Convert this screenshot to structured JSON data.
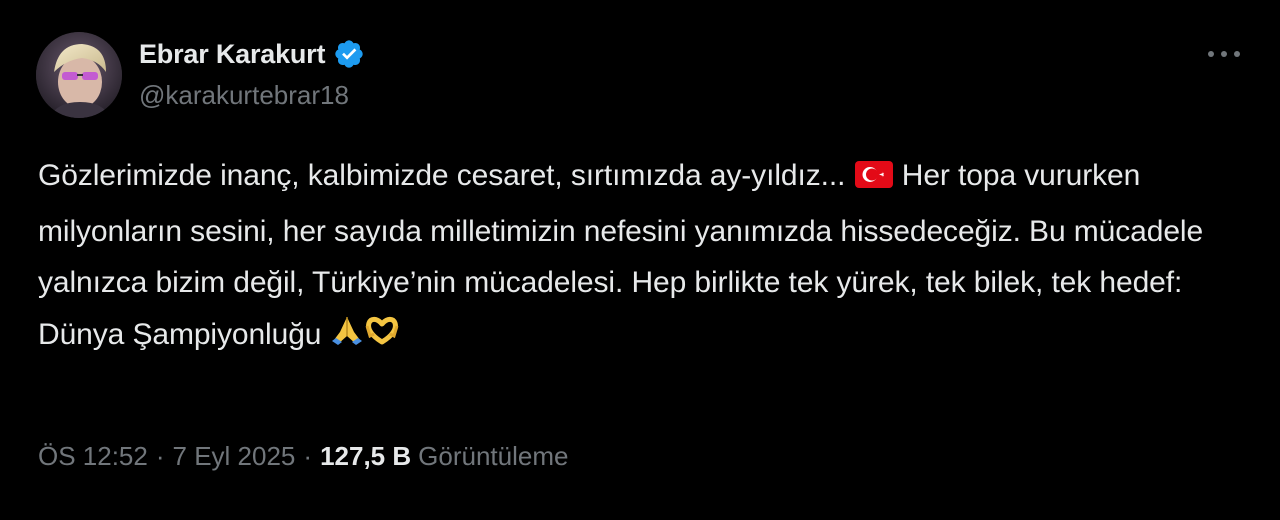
{
  "author": {
    "display_name": "Ebrar Karakurt",
    "handle": "@karakurtebrar18",
    "verified": true,
    "verified_color": "#1d9bf0"
  },
  "tweet": {
    "text_parts": [
      "Gözlerimizde inanç, kalbimizde cesaret, sırtımızda ay-yıldız... ",
      " Her topa vururken milyonların sesini, her sayıda milletimizin nefesini yanımızda hissedeceğiz. Bu mücadele yalnızca bizim değil, Türkiye’nin mücadelesi. Hep birlikte tek yürek, tek bilek, tek hedef: Dünya Şampiyonluğu "
    ],
    "emojis": [
      "turkey-flag",
      "folded-hands",
      "heart-hands"
    ]
  },
  "meta": {
    "time": "ÖS 12:52",
    "date": "7 Eyl 2025",
    "separator": "·",
    "views_count": "127,5 B",
    "views_label": "Görüntüleme"
  },
  "colors": {
    "background": "#000000",
    "text_primary": "#e7e9ea",
    "text_secondary": "#71767b",
    "accent": "#1d9bf0"
  }
}
